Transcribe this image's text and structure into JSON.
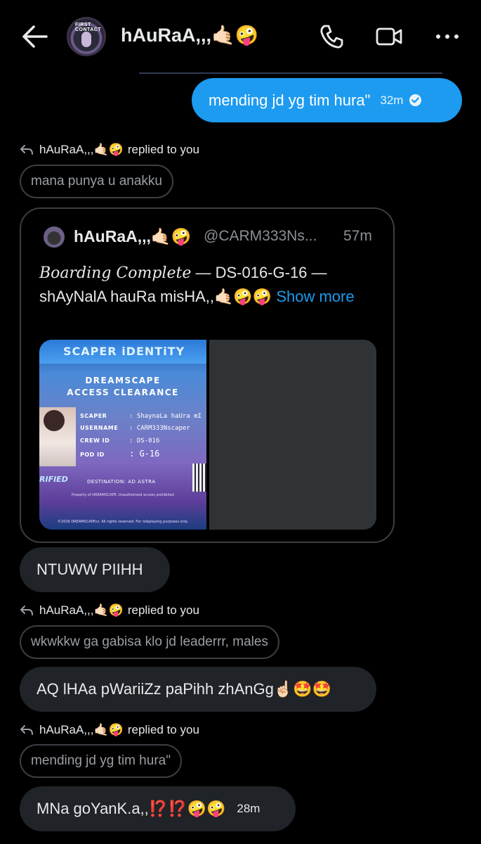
{
  "header": {
    "title": "hAuRaA,,,🤙🏻🤪",
    "avatar_label": "FIRST CONTACT"
  },
  "messages": {
    "sent_1": {
      "text": "mending jd yg tim hura\"",
      "time": "32m"
    },
    "reply_1": {
      "name": "hAuRaA,,,🤙🏻🤪",
      "suffix": "replied to you",
      "quoted": "mana punya u anakku"
    },
    "tweet": {
      "name": "hAuRaA,,,🤙🏻🤪",
      "handle": "@CARM333Ns...",
      "time": "57m",
      "body_italic": "Boarding Complete",
      "body_rest": " — DS-016-G-16 — shAyNalA hauRa misHA,,🤙🏻🤪🤪 ",
      "show_more": "Show more",
      "id_card": {
        "heading": "SCAPER iDENTiTY",
        "subheading_1": "DREAMSCAPE",
        "subheading_2": "ACCESS CLEARANCE",
        "rows": [
          {
            "label": "SCAPER",
            "value": ": ShaynaLa haUra mI"
          },
          {
            "label": "USERNAME",
            "value": ": CARM333Nscaper"
          },
          {
            "label": "CREW ID",
            "value": ": DS-016"
          },
          {
            "label": "POD ID",
            "value": ": G-16"
          }
        ],
        "verified": "RIFIED",
        "destination": "DESTINATION: AD ASTRA",
        "property": "Property of DREAMSCAPE, Unauthorized access prohibited",
        "copyright": "©2026 DREAMSCAPEcz. All rights reserved. For roleplaying purposes only."
      }
    },
    "recv_1": {
      "text": "NTUWW PIIHH"
    },
    "reply_2": {
      "name": "hAuRaA,,,🤙🏻🤪",
      "suffix": "replied to you",
      "quoted": "wkwkkw ga gabisa klo jd leaderrr, males"
    },
    "recv_2": {
      "text": "AQ lHAa pWariiZz paPihh zhAnGg☝🏻🤩🤩"
    },
    "reply_3": {
      "name": "hAuRaA,,,🤙🏻🤪",
      "suffix": "replied to you",
      "quoted": "mending jd yg tim hura\""
    },
    "recv_3": {
      "text": "MNa goYanK.a,,⁉️⁉️🤪🤪",
      "time": "28m"
    }
  },
  "colors": {
    "accent": "#1d9bf0",
    "bubble_received": "#202327",
    "background": "#000000"
  },
  "icons": [
    "back-arrow-icon",
    "phone-icon",
    "video-icon",
    "more-icon",
    "verified-check-icon",
    "reply-arrow-icon"
  ]
}
